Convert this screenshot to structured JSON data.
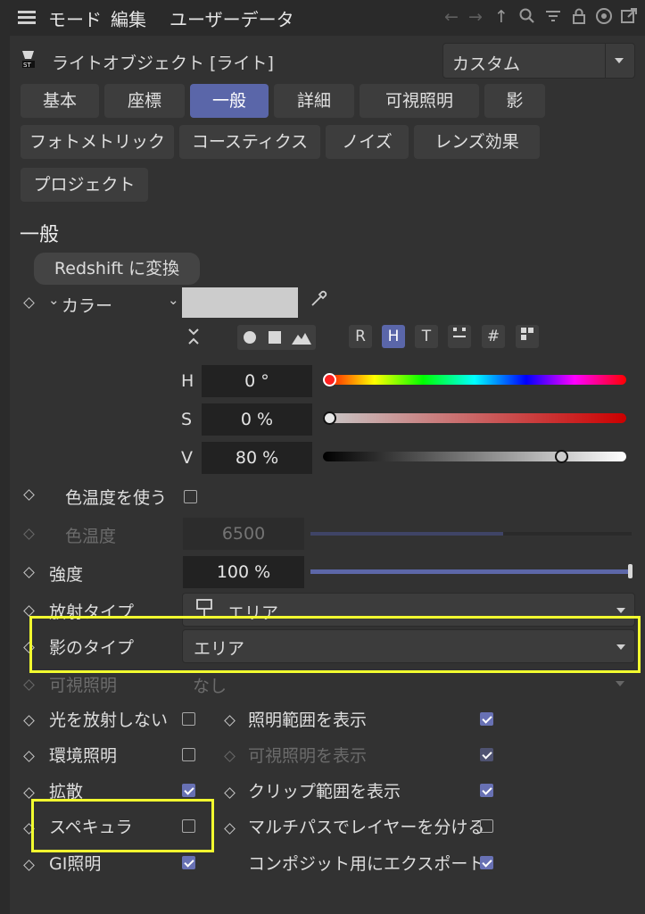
{
  "menu": {
    "mode": "モード",
    "edit": "編集",
    "userdata": "ユーザーデータ"
  },
  "header": {
    "object_title": "ライトオブジェクト [ライト]",
    "preset": "カスタム"
  },
  "tabs": [
    {
      "label": "基本"
    },
    {
      "label": "座標"
    },
    {
      "label": "一般"
    },
    {
      "label": "詳細"
    },
    {
      "label": "可視照明"
    },
    {
      "label": "影"
    },
    {
      "label": "フォトメトリック"
    },
    {
      "label": "コースティクス"
    },
    {
      "label": "ノイズ"
    },
    {
      "label": "レンズ効果"
    },
    {
      "label": "プロジェクト"
    }
  ],
  "section": {
    "title": "一般",
    "convert_button": "Redshift に変換"
  },
  "color": {
    "label": "カラー",
    "swatch": "#cccccc",
    "mode_buttons": [
      "R",
      "H",
      "T",
      "#"
    ],
    "h_label": "H",
    "h_value": "0 °",
    "h_fraction": 0.0,
    "s_label": "S",
    "s_value": "0 %",
    "s_fraction": 0.0,
    "v_label": "V",
    "v_value": "80 %",
    "v_fraction": 0.8
  },
  "props": {
    "use_temp_label": "色温度を使う",
    "temp_label": "色温度",
    "temp_value": "6500",
    "temp_fraction": 0.6,
    "intensity_label": "強度",
    "intensity_value": "100 %",
    "intensity_fraction": 1.0,
    "emit_type_label": "放射タイプ",
    "emit_type_value": "エリア",
    "shadow_type_label": "影のタイプ",
    "shadow_type_value": "エリア",
    "visible_light_label": "可視照明",
    "visible_light_value": "なし"
  },
  "checks": {
    "no_emit": {
      "label": "光を放射しない",
      "checked": false
    },
    "show_range": {
      "label": "照明範囲を表示",
      "checked": true
    },
    "ambient": {
      "label": "環境照明",
      "checked": false
    },
    "show_visible": {
      "label": "可視照明を表示",
      "checked": true
    },
    "diffuse": {
      "label": "拡散",
      "checked": true
    },
    "show_clip": {
      "label": "クリップ範囲を表示",
      "checked": true
    },
    "specular": {
      "label": "スペキュラ",
      "checked": false
    },
    "multipass": {
      "label": "マルチパスでレイヤーを分ける",
      "checked": false
    },
    "gi": {
      "label": "GI照明",
      "checked": true
    },
    "export": {
      "label": "コンポジット用にエクスポート",
      "checked": true
    }
  },
  "colors": {
    "accent": "#5a66a9",
    "highlight": "#f2ff2f"
  }
}
